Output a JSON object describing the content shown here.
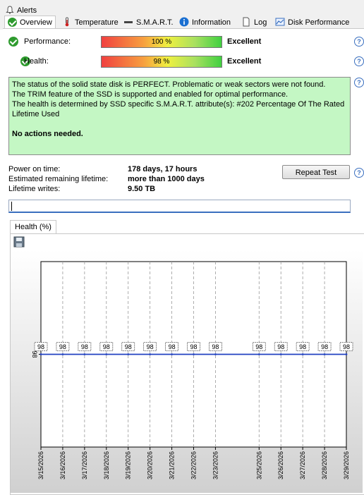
{
  "tabs": {
    "alerts": "Alerts",
    "overview": "Overview",
    "temperature": "Temperature",
    "smart": "S.M.A.R.T.",
    "information": "Information",
    "log": "Log",
    "disk_performance": "Disk Performance"
  },
  "performance": {
    "label": "Performance:",
    "bar_text": "100 %",
    "percent": 100,
    "rating": "Excellent"
  },
  "health": {
    "label": "Health:",
    "bar_text": "98 %",
    "percent": 98,
    "rating": "Excellent"
  },
  "status": {
    "line1": "The status of the solid state disk is PERFECT. Problematic or weak sectors were not found.",
    "line2": "The TRIM feature of the SSD is supported and enabled for optimal performance.",
    "line3": "The health is determined by SSD specific S.M.A.R.T. attribute(s):  #202 Percentage Of The Rated Lifetime Used",
    "actions": "No actions needed."
  },
  "stats": {
    "power_on_label": "Power on time:",
    "power_on_value": "178 days, 17 hours",
    "remaining_label": "Estimated remaining lifetime:",
    "remaining_value": "more than 1000 days",
    "writes_label": "Lifetime writes:",
    "writes_value": "9.50 TB"
  },
  "repeat_test": "Repeat Test",
  "health_tab": "Health (%)",
  "chart_data": {
    "type": "line",
    "x": [
      "3/15/2026",
      "3/16/2026",
      "3/17/2026",
      "3/18/2026",
      "3/19/2026",
      "3/20/2026",
      "3/21/2026",
      "3/22/2026",
      "3/23/2026",
      "3/25/2026",
      "3/26/2026",
      "3/27/2026",
      "3/28/2026",
      "3/29/2026"
    ],
    "values": [
      98,
      98,
      98,
      98,
      98,
      98,
      98,
      98,
      98,
      98,
      98,
      98,
      98,
      98
    ],
    "y_tick_labels": [
      "98"
    ],
    "line_color": "#2040c0"
  },
  "colors": {
    "status_bg": "#c4f7c4",
    "ok_green": "#2e9b2e",
    "link_blue": "#3a6fbf"
  }
}
